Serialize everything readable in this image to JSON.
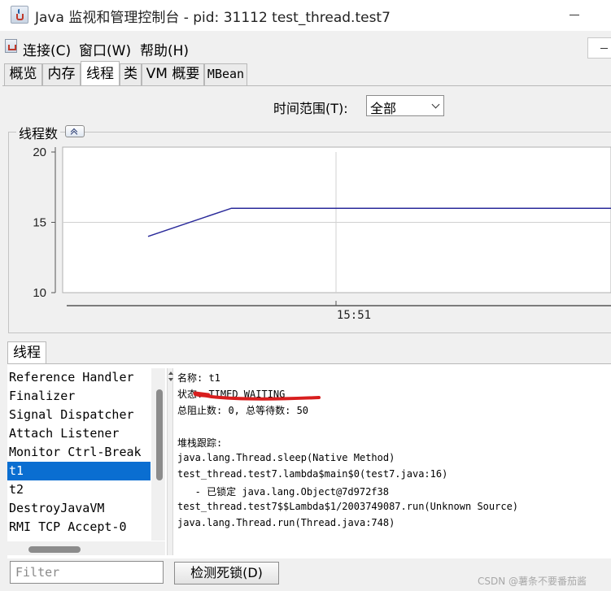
{
  "window": {
    "title": "Java 监视和管理控制台 - pid: 31112 test_thread.test7"
  },
  "menu": {
    "items": [
      "连接(C)",
      "窗口(W)",
      "帮助(H)"
    ]
  },
  "tabs": [
    {
      "label": "概览",
      "active": false
    },
    {
      "label": "内存",
      "active": false
    },
    {
      "label": "线程",
      "active": true
    },
    {
      "label": "类",
      "active": false
    },
    {
      "label": "VM 概要",
      "active": false
    },
    {
      "label": "MBean",
      "active": false
    }
  ],
  "time_range": {
    "label": "时间范围(T):",
    "value": "全部"
  },
  "chart_section": {
    "title": "线程数"
  },
  "chart_data": {
    "type": "line",
    "title": "线程数",
    "xlabel": "",
    "ylabel": "",
    "ylim": [
      10,
      20
    ],
    "y_ticks": [
      10,
      15,
      20
    ],
    "x_tick_labels": [
      "15:51"
    ],
    "grid": true,
    "series": [
      {
        "color": "#2a2a9a",
        "points": [
          [
            0,
            14
          ],
          [
            0.18,
            16
          ],
          [
            1,
            16
          ]
        ]
      }
    ]
  },
  "threads_section": {
    "tab_label": "线程",
    "list": [
      "Reference Handler",
      "Finalizer",
      "Signal Dispatcher",
      "Attach Listener",
      "Monitor Ctrl-Break",
      "t1",
      "t2",
      "DestroyJavaVM",
      "RMI TCP Accept-0"
    ],
    "selected": "t1",
    "detail": {
      "name_line": "名称: t1",
      "state_line": "状态: TIMED_WAITING",
      "counts_line": "总阻止数: 0, 总等待数: 50",
      "stack_header": "堆栈跟踪:",
      "stack": [
        "java.lang.Thread.sleep(Native Method)",
        "test_thread.test7.lambda$main$0(test7.java:16)",
        "   - 已锁定 java.lang.Object@7d972f38",
        "test_thread.test7$$Lambda$1/2003749087.run(Unknown Source)",
        "java.lang.Thread.run(Thread.java:748)"
      ]
    },
    "filter_placeholder": "Filter",
    "deadlock_button": "检测死锁(D)"
  },
  "watermark": "CSDN @薯条不要番茄酱",
  "colors": {
    "selection": "#0a6ed1",
    "series_line": "#2a2a9a",
    "annotation": "#d81e1e"
  }
}
